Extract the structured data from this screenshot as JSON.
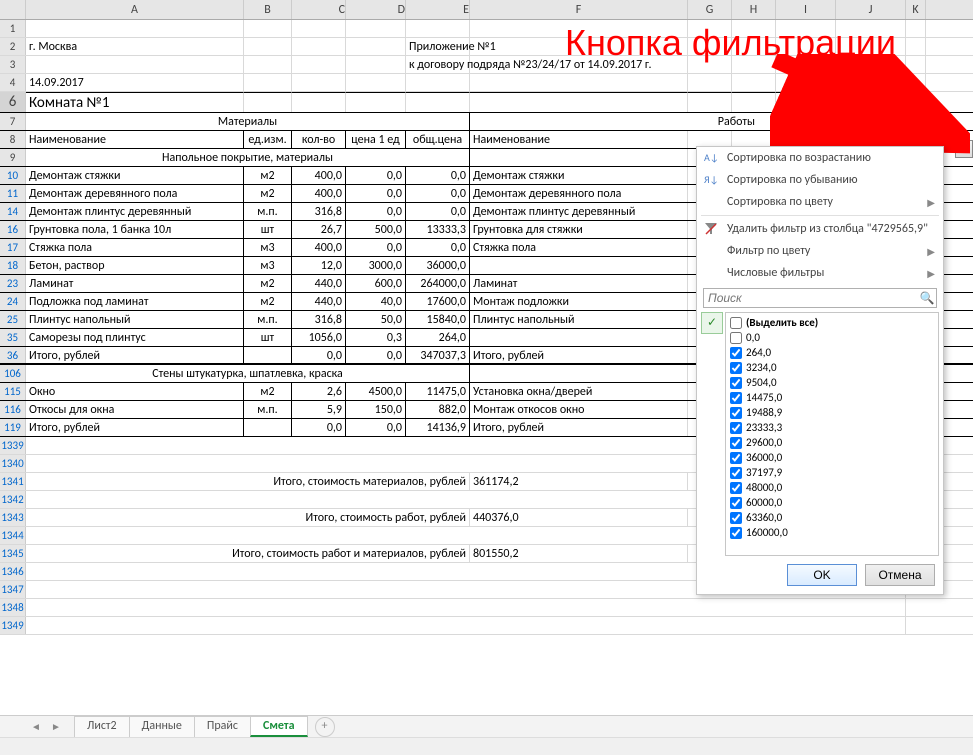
{
  "annotation": "Кнопка фильтрации",
  "columns": [
    "A",
    "B",
    "C",
    "D",
    "E",
    "F",
    "G",
    "H",
    "I",
    "J",
    "K"
  ],
  "col_widths": {
    "A": 218,
    "B": 48,
    "C": 54,
    "D": 60,
    "E": 64,
    "F": 218,
    "G": 44,
    "H": 44,
    "I": 60,
    "J": 70,
    "K": 20
  },
  "rows_header": [
    "1",
    "2",
    "3",
    "4",
    "6",
    "7",
    "8",
    "9",
    "10",
    "11",
    "14",
    "16",
    "17",
    "18",
    "23",
    "24",
    "25",
    "35",
    "36",
    "106",
    "115",
    "116",
    "119",
    "1339",
    "1340",
    "1341",
    "1342",
    "1343",
    "1344",
    "1345",
    "1346",
    "1347",
    "1348",
    "1349"
  ],
  "doc": {
    "city": "г. Москва",
    "title1": "Приложение №1",
    "title2": "к договору подряда №23/24/17 от 14.09.2017 г.",
    "date": "14.09.2017",
    "room": "Комната №1",
    "group_materials": "Материалы",
    "group_works": "Работы",
    "col_name": "Наименование",
    "col_unit": "ед.изм.",
    "col_qty": "кол-во",
    "col_price": "цена 1 ед",
    "col_total": "общ.цена",
    "section_floor": "Напольное покрытие, материалы",
    "section_walls": "Стены штукатурка, шпатлевка, краска",
    "total_mat": "Итого, стоимость материалов, рублей",
    "total_work": "Итого, стоимость работ, рублей",
    "total_all": "Итого, стоимость работ и материалов, рублей",
    "total_mat_val": "361174,2",
    "total_work_val": "440376,0",
    "total_all_val": "801550,2",
    "itogo": "Итого, рублей"
  },
  "data_rows": [
    {
      "r": "10",
      "A": "Демонтаж стяжки",
      "B": "м2",
      "C": "400,0",
      "D": "0,0",
      "E": "0,0",
      "F": "Демонтаж стяжки"
    },
    {
      "r": "11",
      "A": "Демонтаж деревянного пола",
      "B": "м2",
      "C": "400,0",
      "D": "0,0",
      "E": "0,0",
      "F": "Демонтаж деревянного пола"
    },
    {
      "r": "14",
      "A": "Демонтаж плинтус деревянный",
      "B": "м.п.",
      "C": "316,8",
      "D": "0,0",
      "E": "0,0",
      "F": "Демонтаж плинтус деревянный"
    },
    {
      "r": "16",
      "A": "Грунтовка пола, 1 банка 10л",
      "B": "шт",
      "C": "26,7",
      "D": "500,0",
      "E": "13333,3",
      "F": "Грунтовка для стяжки"
    },
    {
      "r": "17",
      "A": "Стяжка пола",
      "B": "м3",
      "C": "400,0",
      "D": "0,0",
      "E": "0,0",
      "F": "Стяжка пола"
    },
    {
      "r": "18",
      "A": "Бетон, раствор",
      "B": "м3",
      "C": "12,0",
      "D": "3000,0",
      "E": "36000,0",
      "F": ""
    },
    {
      "r": "23",
      "A": "Ламинат",
      "B": "м2",
      "C": "440,0",
      "D": "600,0",
      "E": "264000,0",
      "F": "Ламинат"
    },
    {
      "r": "24",
      "A": "Подложка под ламинат",
      "B": "м2",
      "C": "440,0",
      "D": "40,0",
      "E": "17600,0",
      "F": "Монтаж подложки"
    },
    {
      "r": "25",
      "A": "Плинтус напольный",
      "B": "м.п.",
      "C": "316,8",
      "D": "50,0",
      "E": "15840,0",
      "F": "Плинтус напольный"
    },
    {
      "r": "35",
      "A": "Саморезы под плинтус",
      "B": "шт",
      "C": "1056,0",
      "D": "0,3",
      "E": "264,0",
      "F": ""
    },
    {
      "r": "36",
      "A": "Итого, рублей",
      "B": "",
      "C": "0,0",
      "D": "0,0",
      "E": "347037,3",
      "F": "Итого, рублей"
    },
    {
      "r": "115",
      "A": "Окно",
      "B": "м2",
      "C": "2,6",
      "D": "4500,0",
      "E": "11475,0",
      "F": "Установка окна/дверей"
    },
    {
      "r": "116",
      "A": "Откосы для окна",
      "B": "м.п.",
      "C": "5,9",
      "D": "150,0",
      "E": "882,0",
      "F": "Монтаж откосов окно"
    },
    {
      "r": "119",
      "A": "Итого, рублей",
      "B": "",
      "C": "0,0",
      "D": "0,0",
      "E": "14136,9",
      "F": "Итого, рублей"
    }
  ],
  "filter_menu": {
    "sort_asc": "Сортировка по возрастанию",
    "sort_desc": "Сортировка по убыванию",
    "sort_color": "Сортировка по цвету",
    "clear_filter": "Удалить фильтр из столбца \"4729565,9\"",
    "filter_color": "Фильтр по цвету",
    "num_filters": "Числовые фильтры",
    "search_placeholder": "Поиск",
    "select_all": "(Выделить все)",
    "values": [
      "0,0",
      "264,0",
      "3234,0",
      "9504,0",
      "14475,0",
      "19488,9",
      "23333,3",
      "29600,0",
      "36000,0",
      "37197,9",
      "48000,0",
      "60000,0",
      "63360,0",
      "160000,0"
    ],
    "ok": "OK",
    "cancel": "Отмена"
  },
  "tabs": [
    "Лист2",
    "Данные",
    "Прайс",
    "Смета"
  ],
  "active_tab": "Смета"
}
